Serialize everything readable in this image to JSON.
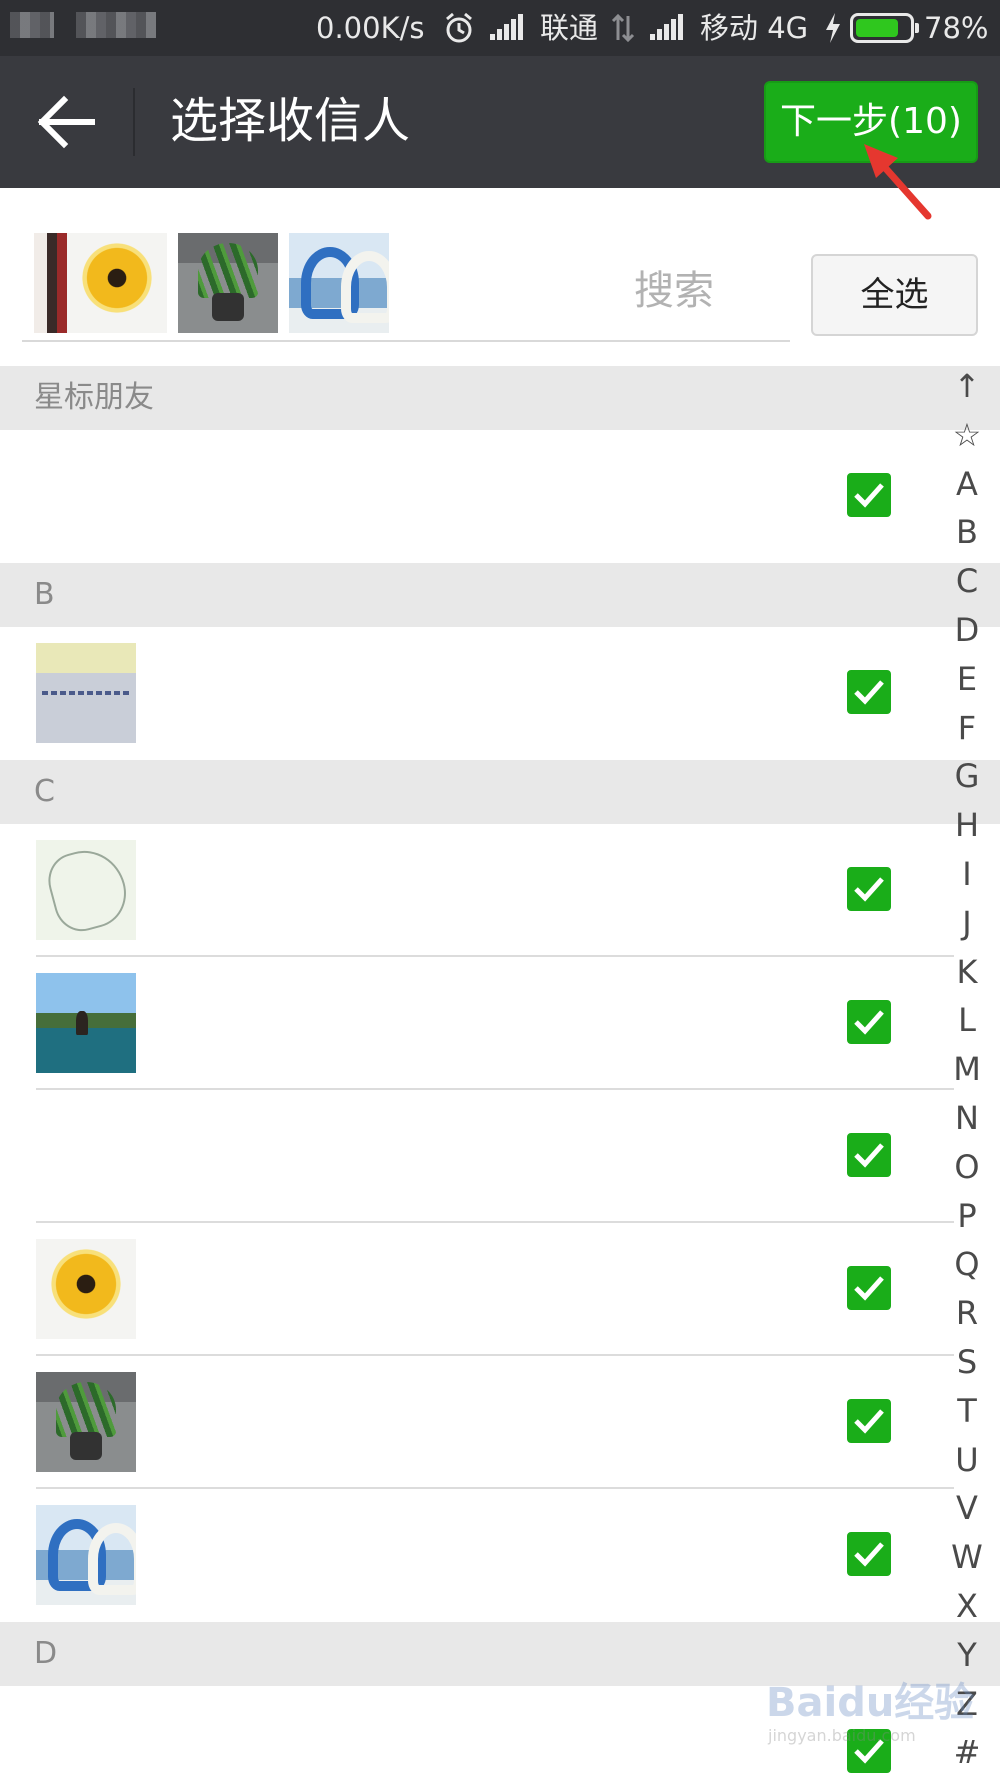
{
  "status_bar": {
    "speed": "0.00K/s",
    "carrier1": "联通",
    "carrier2": "移动 4G",
    "battery": "78%",
    "battery_level": 0.78
  },
  "header": {
    "title": "选择收信人",
    "next_button": "下一步(10)"
  },
  "search": {
    "placeholder": "搜索",
    "select_all": "全选",
    "selected_avatars": [
      "partial",
      "sunflower",
      "plant",
      "swan"
    ]
  },
  "sections": [
    {
      "letter": "星标朋友",
      "rows": [
        {
          "avatar": "none",
          "checked": true
        }
      ]
    },
    {
      "letter": "B",
      "rows": [
        {
          "avatar": "paper",
          "checked": true
        }
      ]
    },
    {
      "letter": "C",
      "rows": [
        {
          "avatar": "sketch",
          "checked": true
        },
        {
          "avatar": "water",
          "checked": true
        },
        {
          "avatar": "none",
          "checked": true
        },
        {
          "avatar": "sunflower",
          "checked": true
        },
        {
          "avatar": "plant",
          "checked": true
        },
        {
          "avatar": "swan",
          "checked": true
        }
      ]
    },
    {
      "letter": "D",
      "rows": [
        {
          "avatar": "none",
          "checked": true
        }
      ]
    }
  ],
  "index_bar": [
    "↑",
    "☆",
    "A",
    "B",
    "C",
    "D",
    "E",
    "F",
    "G",
    "H",
    "I",
    "J",
    "K",
    "L",
    "M",
    "N",
    "O",
    "P",
    "Q",
    "R",
    "S",
    "T",
    "U",
    "V",
    "W",
    "X",
    "Y",
    "Z",
    "#"
  ],
  "watermark": {
    "text": "Baidu经验",
    "sub": "jingyan.baidu.com"
  },
  "colors": {
    "accent_green": "#1aad19",
    "titlebar": "#393a3f",
    "statusbar": "#2e2f33",
    "section_bg": "#e8e8e8"
  }
}
